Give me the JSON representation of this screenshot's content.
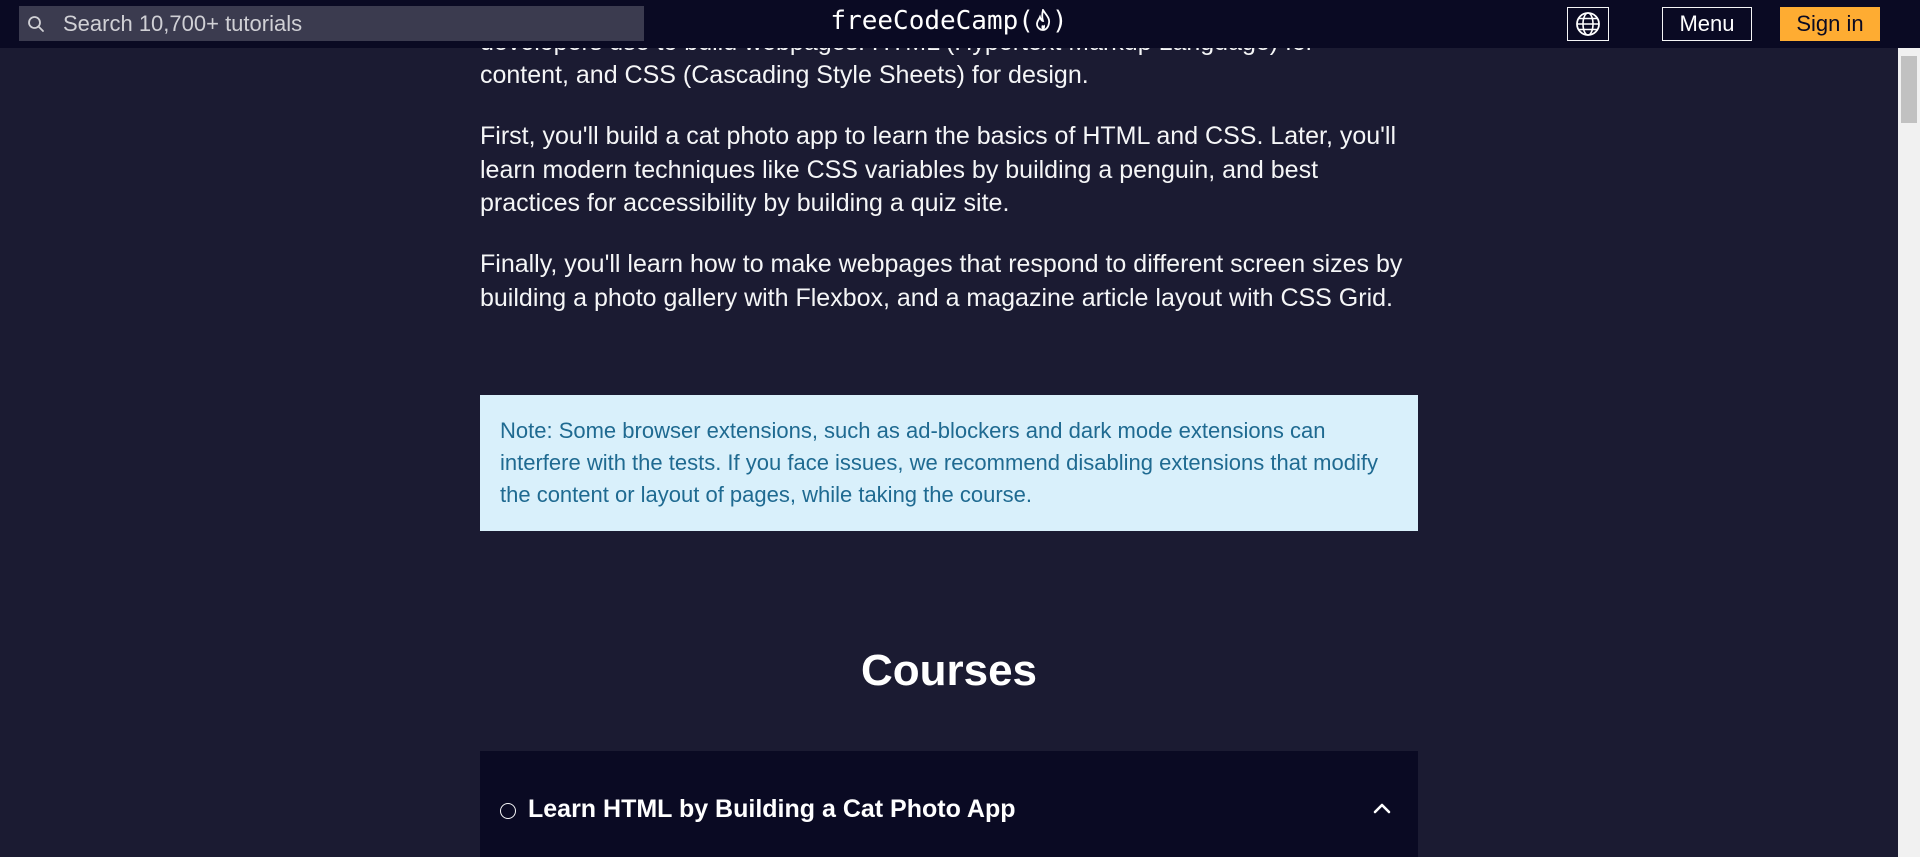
{
  "navbar": {
    "search_placeholder": "Search 10,700+ tutorials",
    "logo_text": "freeCodeCamp(",
    "logo_suffix": ")",
    "menu_label": "Menu",
    "signin_label": "Sign in",
    "icons": {
      "search": "search-icon",
      "logo": "flame-icon",
      "language": "globe-icon"
    }
  },
  "content": {
    "partial_line_1": "developers use to build webpages. HTML (Hypertext Markup Language) for",
    "partial_line_2": "content, and CSS (Cascading Style Sheets) for design.",
    "para_2": "First, you'll build a cat photo app to learn the basics of HTML and CSS. Later, you'll learn modern techniques like CSS variables by building a penguin, and best practices for accessibility by building a quiz site.",
    "para_3": "Finally, you'll learn how to make webpages that respond to different screen sizes by building a photo gallery with Flexbox, and a magazine article layout with CSS Grid.",
    "note": "Note: Some browser extensions, such as ad-blockers and dark mode extensions can interfere with the tests. If you face issues, we recommend disabling extensions that modify the content or layout of pages, while taking the course."
  },
  "courses": {
    "heading": "Courses",
    "items": [
      {
        "title": "Learn HTML by Building a Cat Photo App",
        "icon": "chevron-up-icon"
      }
    ]
  },
  "colors": {
    "background": "#1b1b32",
    "navbar": "#0a0a23",
    "accent": "#feac32",
    "note_bg": "#d9f0fb",
    "note_text": "#1f6a91"
  }
}
